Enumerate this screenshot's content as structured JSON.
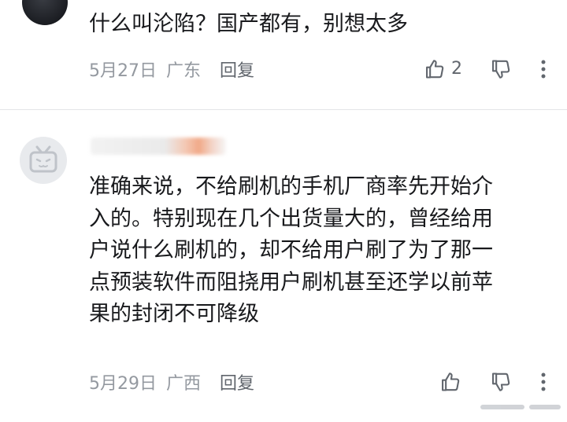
{
  "comments": [
    {
      "text_lines": [
        "什么叫沦陷？国产都有，别想太多"
      ],
      "date": "5月27日",
      "region": "广东",
      "reply_label": "回复",
      "like_count": "2",
      "like_icon": "thumbs-up-icon",
      "dislike_icon": "thumbs-down-icon",
      "more_icon": "more-vertical-icon"
    },
    {
      "avatar_icon": "default-tv-avatar-icon",
      "text_lines": [
        "准确来说，不给刷机的手机厂商率先开始介",
        "入的。特别现在几个出货量大的，曾经给用",
        "户说什么刷机的，却不给用户刷了为了那一",
        "点预装软件而阻挠用户刷机甚至还学以前苹",
        "果的封闭不可降级"
      ],
      "date": "5月29日",
      "region": "广西",
      "reply_label": "回复",
      "like_icon": "thumbs-up-icon",
      "dislike_icon": "thumbs-down-icon",
      "more_icon": "more-vertical-icon"
    }
  ],
  "colors": {
    "text": "#18191c",
    "meta": "#9499a0",
    "divider": "#e3e5e7"
  }
}
